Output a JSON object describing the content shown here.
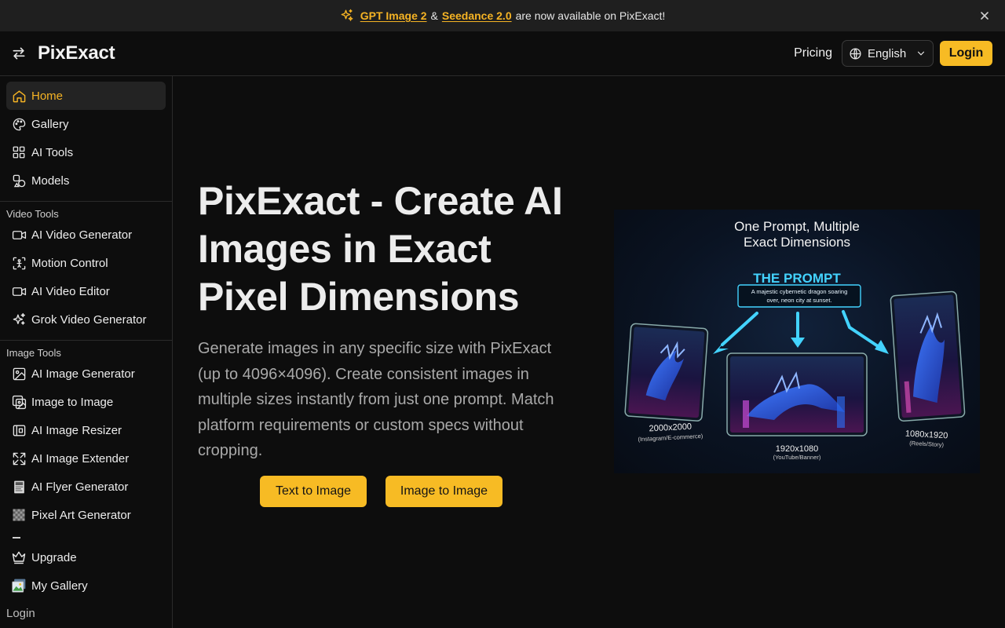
{
  "announcement": {
    "link1": "GPT Image 2",
    "amp": "&",
    "link2": "Seedance 2.0",
    "tail": "are now available on PixExact!"
  },
  "header": {
    "logo": "PixExact",
    "pricing": "Pricing",
    "language": "English",
    "login": "Login"
  },
  "sidebar": {
    "main": [
      {
        "label": "Home",
        "icon": "home-icon"
      },
      {
        "label": "Gallery",
        "icon": "palette-icon"
      },
      {
        "label": "AI Tools",
        "icon": "grid-icon"
      },
      {
        "label": "Models",
        "icon": "shapes-icon"
      }
    ],
    "video_label": "Video Tools",
    "video": [
      {
        "label": "AI Video Generator",
        "icon": "video-icon"
      },
      {
        "label": "Motion Control",
        "icon": "motion-icon"
      },
      {
        "label": "AI Video Editor",
        "icon": "video-icon"
      },
      {
        "label": "Grok Video Generator",
        "icon": "sparkles-icon"
      }
    ],
    "image_label": "Image Tools",
    "image": [
      {
        "label": "AI Image Generator",
        "icon": "image-icon"
      },
      {
        "label": "Image to Image",
        "icon": "images-icon"
      },
      {
        "label": "AI Image Resizer",
        "icon": "resize-icon"
      },
      {
        "label": "AI Image Extender",
        "icon": "expand-icon"
      },
      {
        "label": "AI Flyer Generator",
        "icon": "flyer-icon"
      },
      {
        "label": "Pixel Art Generator",
        "icon": "pixel-icon"
      }
    ],
    "bottom": [
      {
        "label": "Upgrade",
        "icon": "crown-icon"
      },
      {
        "label": "My Gallery",
        "icon": "gallery-icon"
      }
    ],
    "login": "Login"
  },
  "hero": {
    "title": "PixExact - Create AI Images in Exact Pixel Dimensions",
    "description": "Generate images in any specific size with PixExact (up to 4096×4096). Create consistent images in multiple sizes instantly from just one prompt. Match platform requirements or custom specs without cropping.",
    "button1": "Text to Image",
    "button2": "Image to Image"
  },
  "hero_image": {
    "heading_line1": "One Prompt, Multiple",
    "heading_line2": "Exact Dimensions",
    "prompt_title": "THE PROMPT",
    "prompt_line1": "A majestic cybernetic dragon soaring",
    "prompt_line2": "over, neon city at sunset.",
    "left_size": "2000x2000",
    "left_caption": "(Instagram/E-commerce)",
    "center_size": "1920x1080",
    "center_caption": "(YouTube/Banner)",
    "right_size": "1080x1920",
    "right_caption": "(Reels/Story)"
  },
  "colors": {
    "accent": "#f7bb24",
    "background": "#0d0d0d",
    "neon": "#43d3ff"
  }
}
